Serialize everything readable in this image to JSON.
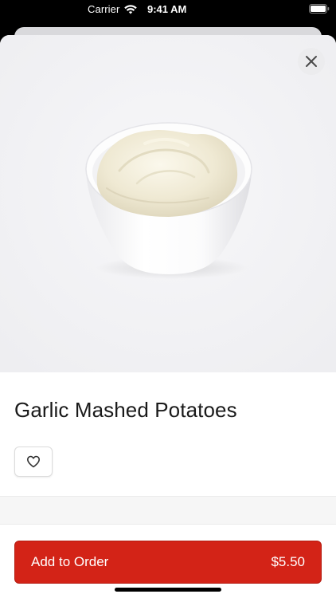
{
  "status_bar": {
    "carrier": "Carrier",
    "time": "9:41 AM",
    "icons": [
      "wifi-icon",
      "battery-icon"
    ]
  },
  "product": {
    "name": "Garlic Mashed Potatoes",
    "image_icon": "mashed-potatoes-bowl-image"
  },
  "actions": {
    "close_icon": "close-icon",
    "favorite_icon": "heart-icon",
    "add_label": "Add to Order",
    "price": "$5.50"
  },
  "colors": {
    "accent": "#d32317",
    "background": "#ffffff",
    "hero_background": "#f3f3f5"
  }
}
